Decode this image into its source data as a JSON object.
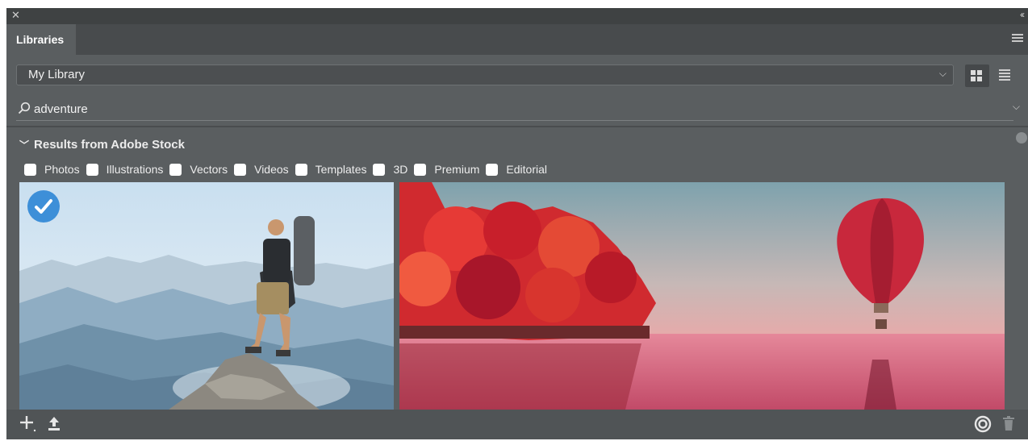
{
  "window": {
    "close_glyph": "✕",
    "collapse_glyph": "‹‹"
  },
  "panel": {
    "tab_label": "Libraries"
  },
  "library_select": {
    "value": "My Library"
  },
  "search": {
    "value": "adventure"
  },
  "results": {
    "header": "Results from Adobe Stock",
    "filters": [
      {
        "label": "Photos",
        "checked": false
      },
      {
        "label": "Illustrations",
        "checked": false
      },
      {
        "label": "Vectors",
        "checked": false
      },
      {
        "label": "Videos",
        "checked": false
      },
      {
        "label": "Templates",
        "checked": false
      },
      {
        "label": "3D",
        "checked": false
      },
      {
        "label": "Premium",
        "checked": false
      },
      {
        "label": "Editorial",
        "checked": false
      }
    ],
    "items": [
      {
        "subject": "hiker on mountain peak",
        "selected": true
      },
      {
        "subject": "red trees and hot air balloon over lake",
        "selected": false
      }
    ]
  },
  "colors": {
    "panel_bg": "#5a5e60",
    "accent_check": "#3d8fd8"
  },
  "icons": [
    "close-icon",
    "collapse-icon",
    "panel-menu-icon",
    "grid-view-icon",
    "list-view-icon",
    "search-icon",
    "chevron-down-icon",
    "add-icon",
    "upload-icon",
    "creative-cloud-icon",
    "trash-icon"
  ]
}
